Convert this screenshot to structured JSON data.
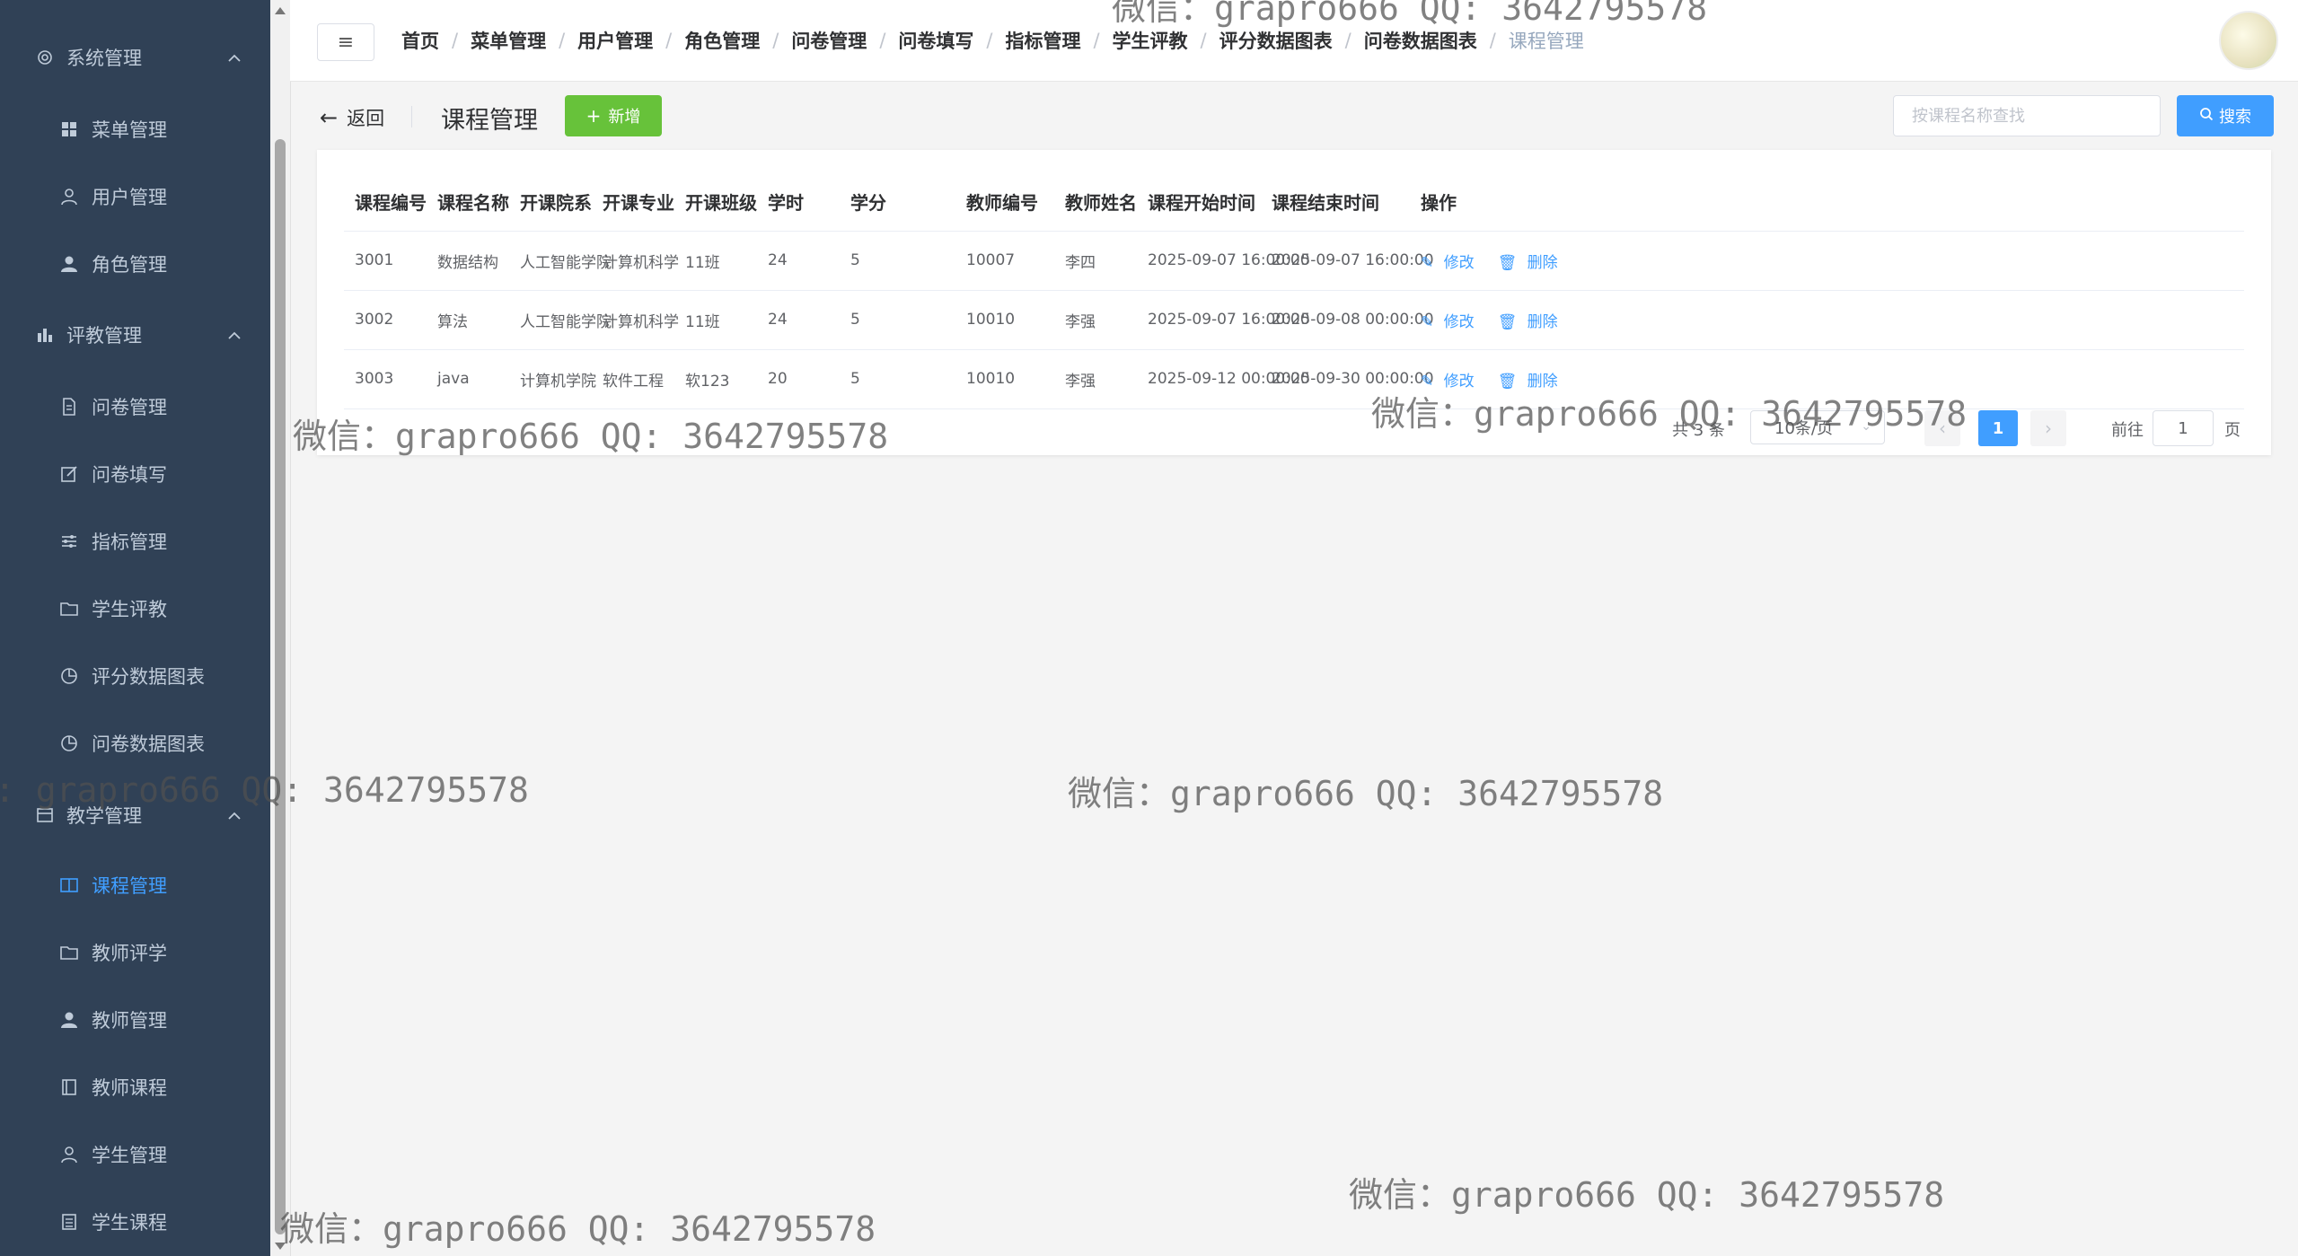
{
  "sidebar": {
    "groups": [
      {
        "label": "系统管理",
        "icon": "gear-icon"
      },
      {
        "label": "评教管理",
        "icon": "bar-chart-icon"
      },
      {
        "label": "教学管理",
        "icon": "table-icon"
      }
    ],
    "items": [
      {
        "label": "菜单管理",
        "icon": "grid-icon"
      },
      {
        "label": "用户管理",
        "icon": "user-icon"
      },
      {
        "label": "角色管理",
        "icon": "user-solid-icon"
      },
      {
        "label": "问卷管理",
        "icon": "document-icon"
      },
      {
        "label": "问卷填写",
        "icon": "edit-icon"
      },
      {
        "label": "指标管理",
        "icon": "sliders-icon"
      },
      {
        "label": "学生评教",
        "icon": "folder-icon"
      },
      {
        "label": "评分数据图表",
        "icon": "pie-chart-icon"
      },
      {
        "label": "问卷数据图表",
        "icon": "pie-chart-icon"
      },
      {
        "label": "课程管理",
        "icon": "book-icon"
      },
      {
        "label": "教师评学",
        "icon": "folder-icon"
      },
      {
        "label": "教师管理",
        "icon": "user-solid-icon"
      },
      {
        "label": "教师课程",
        "icon": "notebook-icon"
      },
      {
        "label": "学生管理",
        "icon": "user-icon"
      },
      {
        "label": "学生课程",
        "icon": "list-icon"
      }
    ]
  },
  "topbar": {
    "hamburger": "≡",
    "breadcrumb": [
      "首页",
      "菜单管理",
      "用户管理",
      "角色管理",
      "问卷管理",
      "问卷填写",
      "指标管理",
      "学生评教",
      "评分数据图表",
      "问卷数据图表",
      "课程管理"
    ]
  },
  "header": {
    "back_label": "返回",
    "title": "课程管理",
    "add_label": "新增",
    "search_placeholder": "按课程名称查找",
    "search_label": "搜索"
  },
  "table": {
    "columns": [
      "课程编号",
      "课程名称",
      "开课院系",
      "开课专业",
      "开课班级",
      "学时",
      "学分",
      "教师编号",
      "教师姓名",
      "课程开始时间",
      "课程结束时间",
      "操作"
    ],
    "rows": [
      [
        "3001",
        "数据结构",
        "人工智能学院",
        "计算机科学",
        "11班",
        "24",
        "5",
        "10007",
        "李四",
        "2025-09-07 16:00:00",
        "2025-09-07 16:00:00"
      ],
      [
        "3002",
        "算法",
        "人工智能学院",
        "计算机科学",
        "11班",
        "24",
        "5",
        "10010",
        "李强",
        "2025-09-07 16:00:00",
        "2025-09-08 00:00:00"
      ],
      [
        "3003",
        "java",
        "计算机学院",
        "软件工程",
        "软123",
        "20",
        "5",
        "10010",
        "李强",
        "2025-09-12 00:00:00",
        "2025-09-30 00:00:00"
      ]
    ],
    "edit_label": "修改",
    "delete_label": "删除"
  },
  "pagination": {
    "total_text": "共 3 条",
    "page_size": "10条/页",
    "current_page": "1",
    "goto_label": "前往",
    "goto_value": "1",
    "page_suffix": "页"
  },
  "watermark": {
    "text": "微信：grapro666 QQ: 3642795578",
    "text_cut": ": grapro666 QQ: 3642795578"
  },
  "colors": {
    "sidebar_bg": "#304156",
    "sidebar_text": "#bfcbd9",
    "accent": "#409eff",
    "success": "#67c23a"
  }
}
